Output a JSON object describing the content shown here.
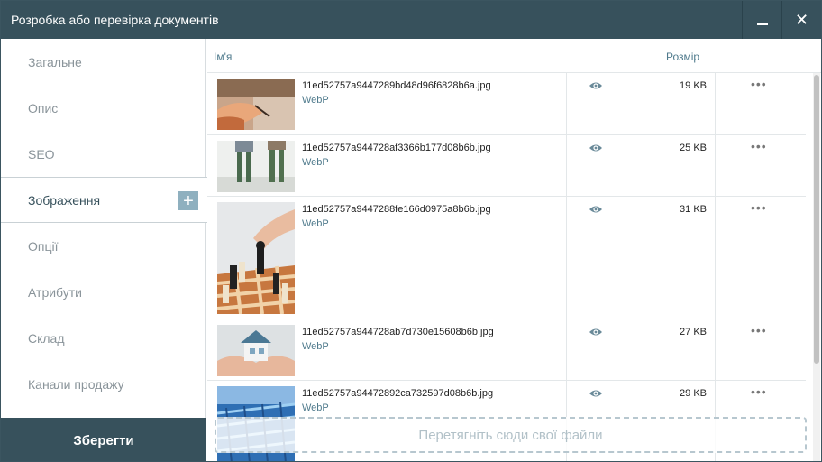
{
  "window": {
    "title": "Розробка або перевірка документів",
    "minimize_icon": "minimize-icon",
    "close_icon": "close-icon",
    "close_glyph": "✕"
  },
  "sidebar": {
    "items": [
      {
        "label": "Загальне",
        "active": false
      },
      {
        "label": "Опис",
        "active": false
      },
      {
        "label": "SEO",
        "active": false
      },
      {
        "label": "Зображення",
        "active": true
      },
      {
        "label": "Опції",
        "active": false
      },
      {
        "label": "Атрибути",
        "active": false
      },
      {
        "label": "Склад",
        "active": false
      },
      {
        "label": "Канали продажу",
        "active": false
      }
    ],
    "add_glyph": "+",
    "save_label": "Зберегти"
  },
  "table": {
    "columns": {
      "name": "Ім'я",
      "size": "Розмір"
    },
    "rows": [
      {
        "filename": "11ed52757a9447289bd48d96f6828b6a.jpg",
        "format": "WebP",
        "size": "19 KB",
        "thumb": "hand-writing"
      },
      {
        "filename": "11ed52757a944728af3366b177d08b6b.jpg",
        "format": "WebP",
        "size": "25 KB",
        "thumb": "rubber-boots"
      },
      {
        "filename": "11ed52757a9447288fe166d0975a8b6b.jpg",
        "format": "WebP",
        "size": "31 KB",
        "thumb": "chess-hand"
      },
      {
        "filename": "11ed52757a944728ab7d730e15608b6b.jpg",
        "format": "WebP",
        "size": "27 KB",
        "thumb": "house-in-hands"
      },
      {
        "filename": "11ed52757a94472892ca732597d08b6b.jpg",
        "format": "WebP",
        "size": "29 KB",
        "thumb": "blue-circuit"
      }
    ],
    "eye_icon": "eye-icon",
    "more_glyph": "•••"
  },
  "dropzone": {
    "label": "Перетягніть сюди свої файли"
  },
  "colors": {
    "primary": "#37515c",
    "accent": "#4f7a8c",
    "add_button": "#8fb0bf"
  }
}
